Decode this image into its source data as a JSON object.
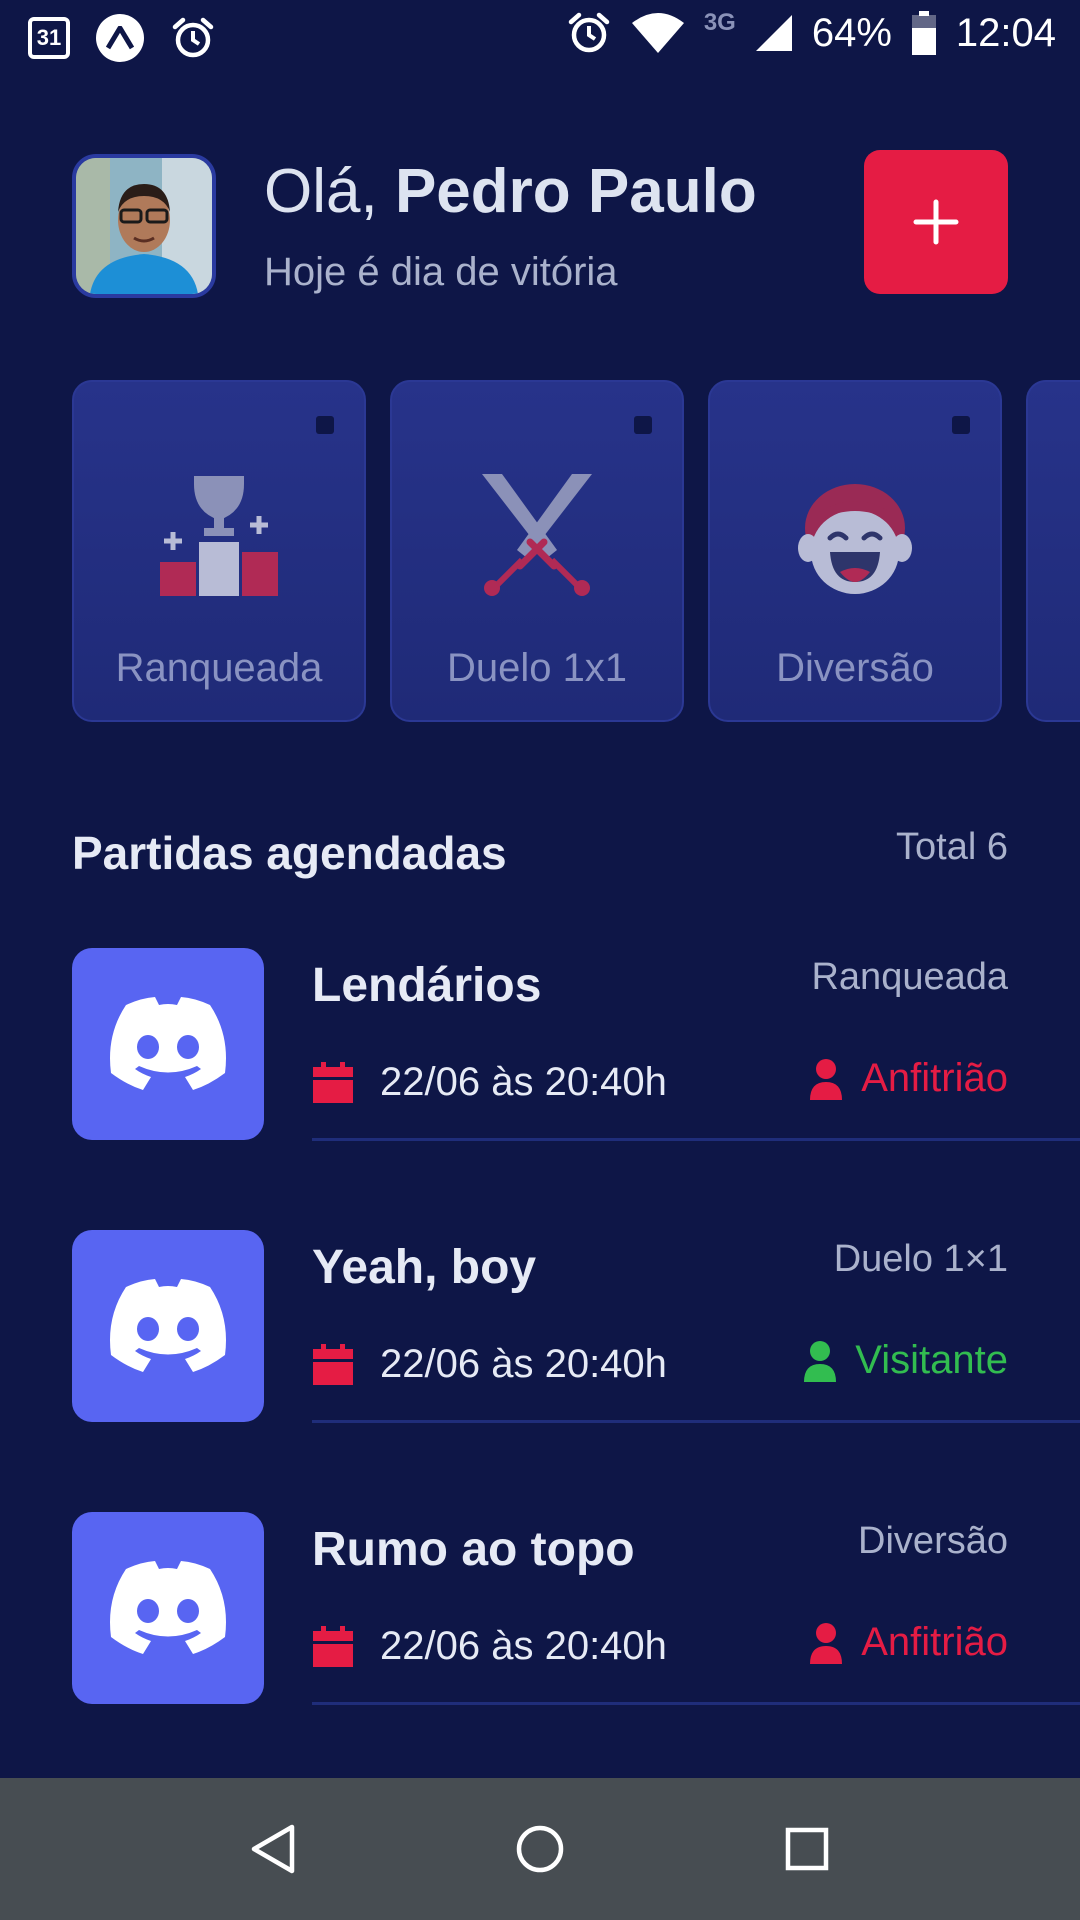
{
  "status_bar": {
    "calendar_day": "31",
    "network": "3G",
    "battery": "64%",
    "time": "12:04"
  },
  "header": {
    "greeting_prefix": "Olá,",
    "user_name": "Pedro Paulo",
    "subtitle": "Hoje é dia de vitória",
    "add_label": "+"
  },
  "categories": [
    {
      "label": "Ranqueada",
      "icon": "trophy-podium-icon"
    },
    {
      "label": "Duelo 1x1",
      "icon": "crossed-swords-icon"
    },
    {
      "label": "Diversão",
      "icon": "laughing-face-icon"
    }
  ],
  "matches_section": {
    "title": "Partidas agendadas",
    "total": "Total 6"
  },
  "matches": [
    {
      "name": "Lendários",
      "category": "Ranqueada",
      "date": "22/06 às 20:40h",
      "role": "Anfitrião",
      "role_color": "#e51c44",
      "icon": "discord-icon"
    },
    {
      "name": "Yeah, boy",
      "category": "Duelo 1×1",
      "date": "22/06 às 20:40h",
      "role": "Visitante",
      "role_color": "#32bd50",
      "icon": "discord-icon"
    },
    {
      "name": "Rumo ao topo",
      "category": "Diversão",
      "date": "22/06 às 20:40h",
      "role": "Anfitrião",
      "role_color": "#e51c44",
      "icon": "discord-icon"
    }
  ],
  "colors": {
    "background": "#0e1647",
    "accent": "#e51c44",
    "discord": "#5865f2",
    "success": "#32bd50"
  }
}
